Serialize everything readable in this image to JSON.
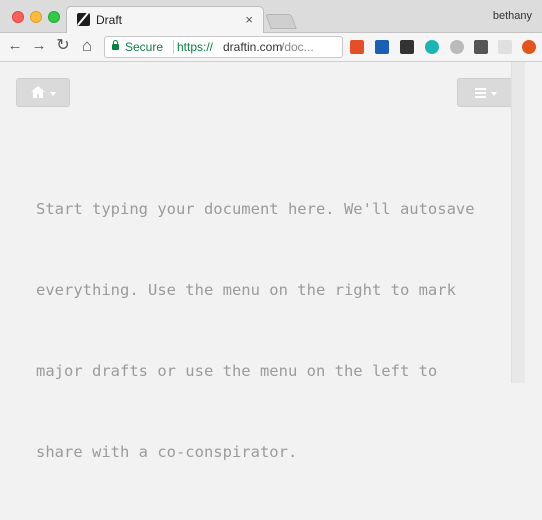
{
  "window": {
    "profile_name": "bethany"
  },
  "tab": {
    "title": "Draft",
    "close_glyph": "×"
  },
  "toolbar": {
    "back_glyph": "←",
    "forward_glyph": "→",
    "reload_glyph": "↻",
    "home_glyph": "⌂",
    "star_glyph": "☆",
    "secure_label": "Secure",
    "url_scheme": "https://",
    "url_host": "draftin.com",
    "url_path": "/doc..."
  },
  "extensions": [
    {
      "icon": "dashlane-icon",
      "color": "#e34f26"
    },
    {
      "icon": "evernote-icon",
      "color": "#1a5fb4"
    },
    {
      "icon": "tab-icon",
      "color": "#333333"
    },
    {
      "icon": "teal-circle-icon",
      "color": "#1db4b4"
    },
    {
      "icon": "grey-circle-icon",
      "color": "#bbbbbb"
    },
    {
      "icon": "pocket-icon",
      "color": "#555555"
    },
    {
      "icon": "square-icon",
      "color": "#e0e0e0"
    },
    {
      "icon": "ublock-icon",
      "color": "#e1561d"
    }
  ],
  "editor": {
    "lines": [
      "Start typing your document here. We'll autosave",
      "everything. Use the menu on the right to mark",
      "major drafts or use the menu on the left to",
      "share with a co-conspirator."
    ]
  }
}
